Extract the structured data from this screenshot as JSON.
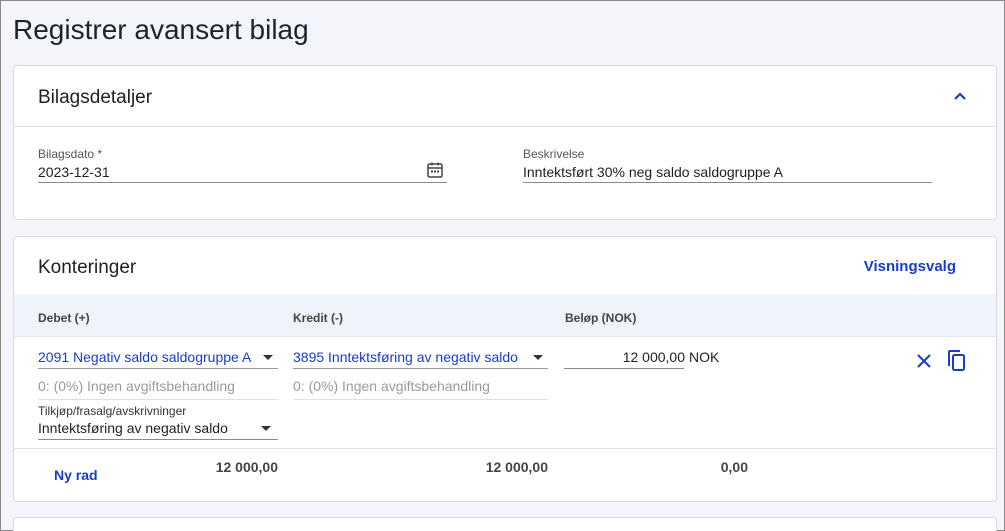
{
  "page": {
    "title": "Registrer avansert bilag"
  },
  "details": {
    "title": "Bilagsdetaljer",
    "toggle_icon": "chevron-up-icon",
    "date_label": "Bilagsdato *",
    "date_value": "2023-12-31",
    "description_label": "Beskrivelse",
    "description_value": "Inntektsført 30%  neg saldo saldogruppe A"
  },
  "postings": {
    "title": "Konteringer",
    "view_options": "Visningsvalg",
    "columns": {
      "debit": "Debet (+)",
      "credit": "Kredit (-)",
      "amount": "Beløp (NOK)"
    },
    "row": {
      "debit_account": "2091 Negativ saldo saldogruppe A",
      "debit_vat": "0: (0%) Ingen avgiftsbehandling",
      "credit_account": "3895 Inntektsføring av negativ saldo",
      "credit_vat": "0: (0%) Ingen avgiftsbehandling",
      "amount": "12 000,00",
      "currency": "NOK",
      "dimension_label": "Tilkjøp/frasalg/avskrivninger",
      "dimension_value": "Inntektsføring av negativ saldo"
    },
    "footer": {
      "new_row": "Ny rad",
      "debit_total": "12 000,00",
      "credit_total": "12 000,00",
      "difference": "0,00"
    }
  },
  "colors": {
    "accent": "#1a3ccc",
    "header_bg": "#eef3fc",
    "page_bg": "#f3f5fa"
  }
}
